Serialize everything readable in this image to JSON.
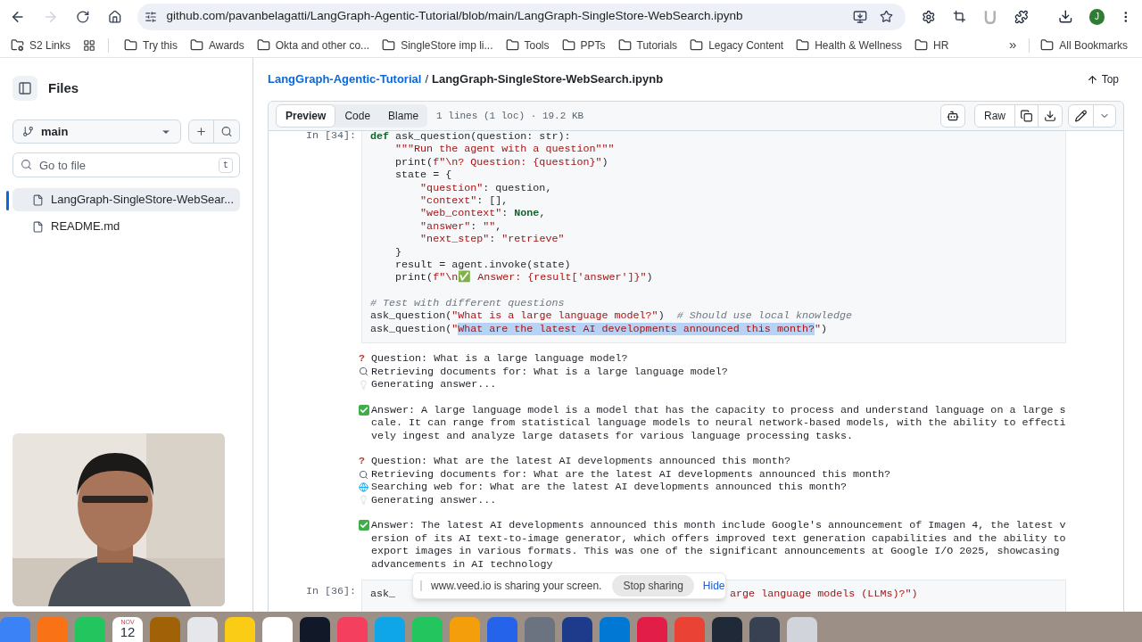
{
  "browser": {
    "url": "github.com/pavanbelagatti/LangGraph-Agentic-Tutorial/blob/main/LangGraph-SingleStore-WebSearch.ipynb",
    "profile": "J",
    "forward_disabled": true
  },
  "bookmarks": [
    {
      "label": "S2 Links",
      "kind": "special"
    },
    {
      "kind": "apps"
    },
    {
      "label": "Try this",
      "kind": "folder"
    },
    {
      "label": "Awards",
      "kind": "folder"
    },
    {
      "label": "Okta and other co...",
      "kind": "folder"
    },
    {
      "label": "SingleStore imp li...",
      "kind": "folder"
    },
    {
      "label": "Tools",
      "kind": "folder"
    },
    {
      "label": "PPTs",
      "kind": "folder"
    },
    {
      "label": "Tutorials",
      "kind": "folder"
    },
    {
      "label": "Legacy Content",
      "kind": "folder"
    },
    {
      "label": "Health & Wellness",
      "kind": "folder"
    },
    {
      "label": "HR",
      "kind": "folder"
    }
  ],
  "bookmarks_more": "»",
  "all_bookmarks": "All Bookmarks",
  "sidebar": {
    "title": "Files",
    "branch": "main",
    "search": {
      "placeholder": "Go to file",
      "shortcut": "t"
    },
    "files": [
      {
        "name": "LangGraph-SingleStore-WebSear...",
        "selected": true
      },
      {
        "name": "README.md",
        "selected": false
      }
    ]
  },
  "breadcrumb": {
    "repo": "LangGraph-Agentic-Tutorial",
    "separator": "/",
    "file": "LangGraph-SingleStore-WebSearch.ipynb",
    "top": "Top"
  },
  "tabs": [
    {
      "label": "Preview",
      "selected": true
    },
    {
      "label": "Code",
      "selected": false
    },
    {
      "label": "Blame",
      "selected": false
    }
  ],
  "file_info": "1 lines (1 loc) · 19.2 KB",
  "raw": "Raw",
  "cell": {
    "prompt": "In [34]:",
    "lines": [
      {
        "kind": "code",
        "tokens": [
          {
            "kind": "keyword",
            "text": "def"
          },
          {
            "kind": "plain",
            "text": " ask_question(question: str):"
          }
        ]
      },
      {
        "kind": "code",
        "tokens": [
          {
            "kind": "string",
            "text": "    \"\"\"Run the agent with a question\"\"\""
          }
        ]
      },
      {
        "kind": "code",
        "tokens": [
          {
            "kind": "plain",
            "text": "    print("
          },
          {
            "kind": "string",
            "text": "f\"\\n? Question: {question}\""
          },
          {
            "kind": "plain",
            "text": ")"
          }
        ]
      },
      {
        "kind": "code",
        "tokens": [
          {
            "kind": "plain",
            "text": "    state = {"
          }
        ]
      },
      {
        "kind": "code",
        "tokens": [
          {
            "kind": "string",
            "text": "        \"question\""
          },
          {
            "kind": "plain",
            "text": ": question,"
          }
        ]
      },
      {
        "kind": "code",
        "tokens": [
          {
            "kind": "string",
            "text": "        \"context\""
          },
          {
            "kind": "plain",
            "text": ": [],"
          }
        ]
      },
      {
        "kind": "code",
        "tokens": [
          {
            "kind": "string",
            "text": "        \"web_context\""
          },
          {
            "kind": "plain",
            "text": ": "
          },
          {
            "kind": "keyword",
            "text": "None"
          },
          {
            "kind": "plain",
            "text": ","
          }
        ]
      },
      {
        "kind": "code",
        "tokens": [
          {
            "kind": "string",
            "text": "        \"answer\""
          },
          {
            "kind": "plain",
            "text": ": "
          },
          {
            "kind": "string",
            "text": "\"\""
          },
          {
            "kind": "plain",
            "text": ","
          }
        ]
      },
      {
        "kind": "code",
        "tokens": [
          {
            "kind": "string",
            "text": "        \"next_step\""
          },
          {
            "kind": "plain",
            "text": ": "
          },
          {
            "kind": "string",
            "text": "\"retrieve\""
          }
        ]
      },
      {
        "kind": "code",
        "tokens": [
          {
            "kind": "plain",
            "text": "    }"
          }
        ]
      },
      {
        "kind": "code",
        "tokens": [
          {
            "kind": "plain",
            "text": "    result = agent.invoke(state)"
          }
        ]
      },
      {
        "kind": "code",
        "tokens": [
          {
            "kind": "plain",
            "text": "    print("
          },
          {
            "kind": "string",
            "text": "f\"\\n✅ Answer: {result['answer']}\""
          },
          {
            "kind": "plain",
            "text": ")"
          }
        ]
      },
      {
        "kind": "blank"
      },
      {
        "kind": "code",
        "tokens": [
          {
            "kind": "comment",
            "text": "# Test with different questions"
          }
        ]
      },
      {
        "kind": "code",
        "tokens": [
          {
            "kind": "plain",
            "text": "ask_question("
          },
          {
            "kind": "string",
            "text": "\"What is a large language model?\""
          },
          {
            "kind": "plain",
            "text": ")  "
          },
          {
            "kind": "comment",
            "text": "# Should use local knowledge"
          }
        ]
      },
      {
        "kind": "code",
        "tokens": [
          {
            "kind": "plain",
            "text": "ask_question("
          },
          {
            "kind": "string",
            "text": "\""
          },
          {
            "kind": "selected",
            "text": "What are the latest AI developments announced this month?"
          },
          {
            "kind": "string",
            "text": "\""
          },
          {
            "kind": "plain",
            "text": ")"
          }
        ]
      }
    ]
  },
  "output": [
    {
      "kind": "question",
      "mark": "?",
      "text": "Question: What is a large language model?"
    },
    {
      "kind": "search",
      "text": "Retrieving documents for: What is a large language model?"
    },
    {
      "kind": "bulb",
      "text": "Generating answer..."
    },
    {
      "kind": "gap"
    },
    {
      "kind": "answer",
      "text": "Answer: A large language model is a model that has the capacity to process and understand language on a large scale. It can range from statistical language models to neural network-based models, with the ability to effectively ingest and analyze large datasets for various language processing tasks."
    },
    {
      "kind": "gap"
    },
    {
      "kind": "question",
      "mark": "?",
      "text": "Question: What are the latest AI developments announced this month?"
    },
    {
      "kind": "search",
      "text": "Retrieving documents for: What are the latest AI developments announced this month?"
    },
    {
      "kind": "globe",
      "text": "Searching web for: What are the latest AI developments announced this month?"
    },
    {
      "kind": "bulb",
      "text": "Generating answer..."
    },
    {
      "kind": "gap"
    },
    {
      "kind": "answer",
      "text": "Answer: The latest AI developments announced this month include Google's announcement of Imagen 4, the latest version of its AI text-to-image generator, which offers improved text generation capabilities and the ability to export images in various formats. This was one of the significant announcements at Google I/O 2025, showcasing advancements in AI technology"
    }
  ],
  "next_cell": {
    "prompt": "In [36]:",
    "start": "ask_",
    "end": "arge language models (LLMs)?\")"
  },
  "share_bar": {
    "message": "www.veed.io is sharing your screen.",
    "stop": "Stop sharing",
    "hide": "Hide"
  },
  "dock": [
    {
      "color": "#3b82f6"
    },
    {
      "color": "#f97316"
    },
    {
      "color": "#22c55e"
    },
    {
      "kind": "calendar",
      "month": "NOV",
      "day": "12"
    },
    {
      "color": "#a16207"
    },
    {
      "color": "#e5e7eb"
    },
    {
      "color": "#facc15"
    },
    {
      "color": "#ffffff"
    },
    {
      "color": "#111827"
    },
    {
      "color": "#f43f5e"
    },
    {
      "color": "#0ea5e9"
    },
    {
      "color": "#22c55e"
    },
    {
      "color": "#f59e0b"
    },
    {
      "color": "#2563eb"
    },
    {
      "color": "#6b7280"
    },
    {
      "color": "#1e3a8a"
    },
    {
      "color": "#0078d4"
    },
    {
      "color": "#e11d48"
    },
    {
      "color": "#ea4335"
    },
    {
      "color": "#1f2937"
    },
    {
      "color": "#374151"
    },
    {
      "color": "#d1d5db"
    }
  ]
}
